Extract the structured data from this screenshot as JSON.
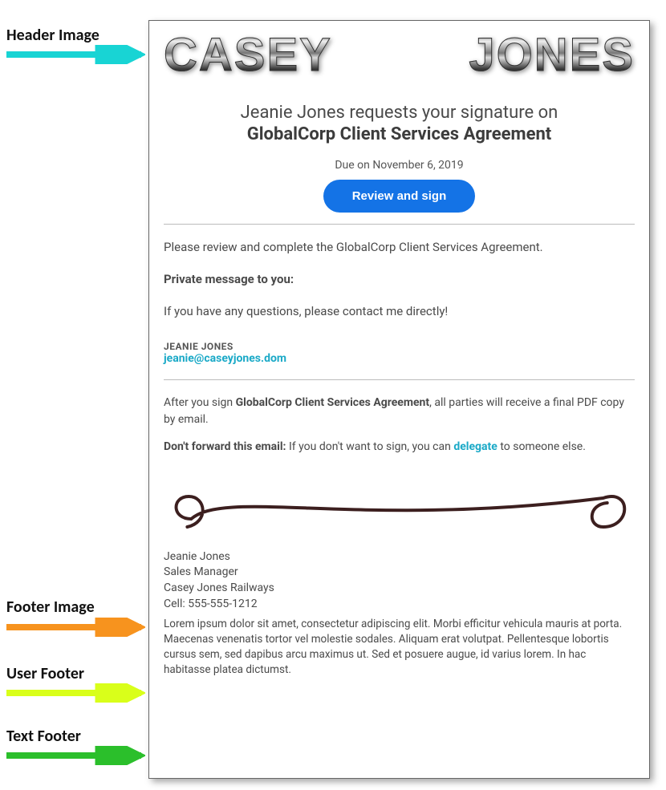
{
  "callouts": {
    "header_image": "Header Image",
    "footer_image": "Footer Image",
    "user_footer": "User Footer",
    "text_footer": "Text Footer"
  },
  "logo": {
    "first": "CASEY",
    "last": "JONES"
  },
  "title": {
    "line1": "Jeanie Jones requests your signature on",
    "line2": "GlobalCorp Client Services Agreement"
  },
  "due": "Due on November 6, 2019",
  "cta_label": "Review and sign",
  "body": {
    "intro": "Please review and complete the GlobalCorp Client Services Agreement.",
    "pm_label": "Private message to you:",
    "pm_body": "If you have any questions, please contact me directly!"
  },
  "sender": {
    "name": "JEANIE JONES",
    "email": "jeanie@caseyjones.dom"
  },
  "after_sign": {
    "prefix": "After you sign ",
    "doc": "GlobalCorp Client Services Agreement",
    "suffix": ", all parties will receive a final PDF copy by email."
  },
  "dont_forward": {
    "bold": "Don't forward this email:",
    "mid": " If you don't want to sign, you can ",
    "link": "delegate",
    "tail": " to someone else."
  },
  "user_footer": {
    "name": "Jeanie Jones",
    "title": "Sales Manager",
    "company": "Casey Jones Railways",
    "cell": "Cell: 555-555-1212"
  },
  "text_footer": "Lorem ipsum dolor sit amet, consectetur adipiscing elit. Morbi efficitur vehicula mauris at porta. Maecenas venenatis tortor vel molestie sodales. Aliquam erat volutpat. Pellentesque lobortis cursus sem, sed dapibus arcu maximus ut. Sed et posuere augue, id varius lorem. In hac habitasse platea dictumst."
}
